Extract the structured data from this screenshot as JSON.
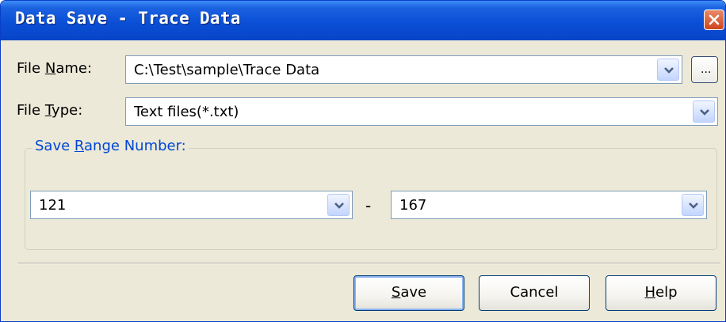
{
  "window": {
    "title": "Data Save - Trace Data"
  },
  "file_name": {
    "label_prefix": "File ",
    "label_mnemonic": "N",
    "label_suffix": "ame:",
    "value": "C:\\Test\\sample\\Trace Data",
    "browse_label": "..."
  },
  "file_type": {
    "label_prefix": "File ",
    "label_mnemonic": "T",
    "label_suffix": "ype:",
    "value": "Text files(*.txt)"
  },
  "save_range": {
    "legend_prefix": "Save ",
    "legend_mnemonic": "R",
    "legend_suffix": "ange Number:",
    "from_value": "121",
    "separator": "-",
    "to_value": "167"
  },
  "buttons": {
    "save_mnemonic": "S",
    "save_rest": "ave",
    "cancel": "Cancel",
    "help_mnemonic": "H",
    "help_rest": "elp"
  },
  "colors": {
    "titlebar": "#0a4fd6",
    "face": "#ece9d8",
    "group_legend": "#0046d5"
  }
}
